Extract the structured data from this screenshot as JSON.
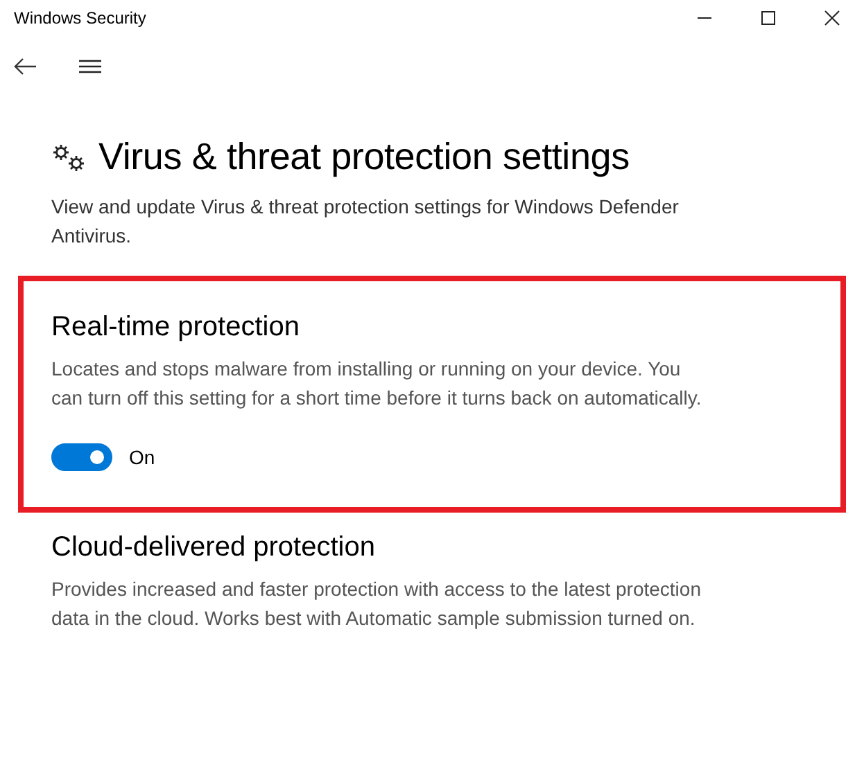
{
  "window": {
    "title": "Windows Security"
  },
  "page": {
    "title": "Virus & threat protection settings",
    "description": "View and update Virus & threat protection settings for Windows Defender Antivirus."
  },
  "sections": [
    {
      "title": "Real-time protection",
      "description": "Locates and stops malware from installing or running on your device. You can turn off this setting for a short time before it turns back on automatically.",
      "highlighted": true,
      "toggle": {
        "on": true,
        "label": "On"
      }
    },
    {
      "title": "Cloud-delivered protection",
      "description": "Provides increased and faster protection with access to the latest protection data in the cloud.  Works best with Automatic sample submission turned on.",
      "highlighted": false
    }
  ]
}
